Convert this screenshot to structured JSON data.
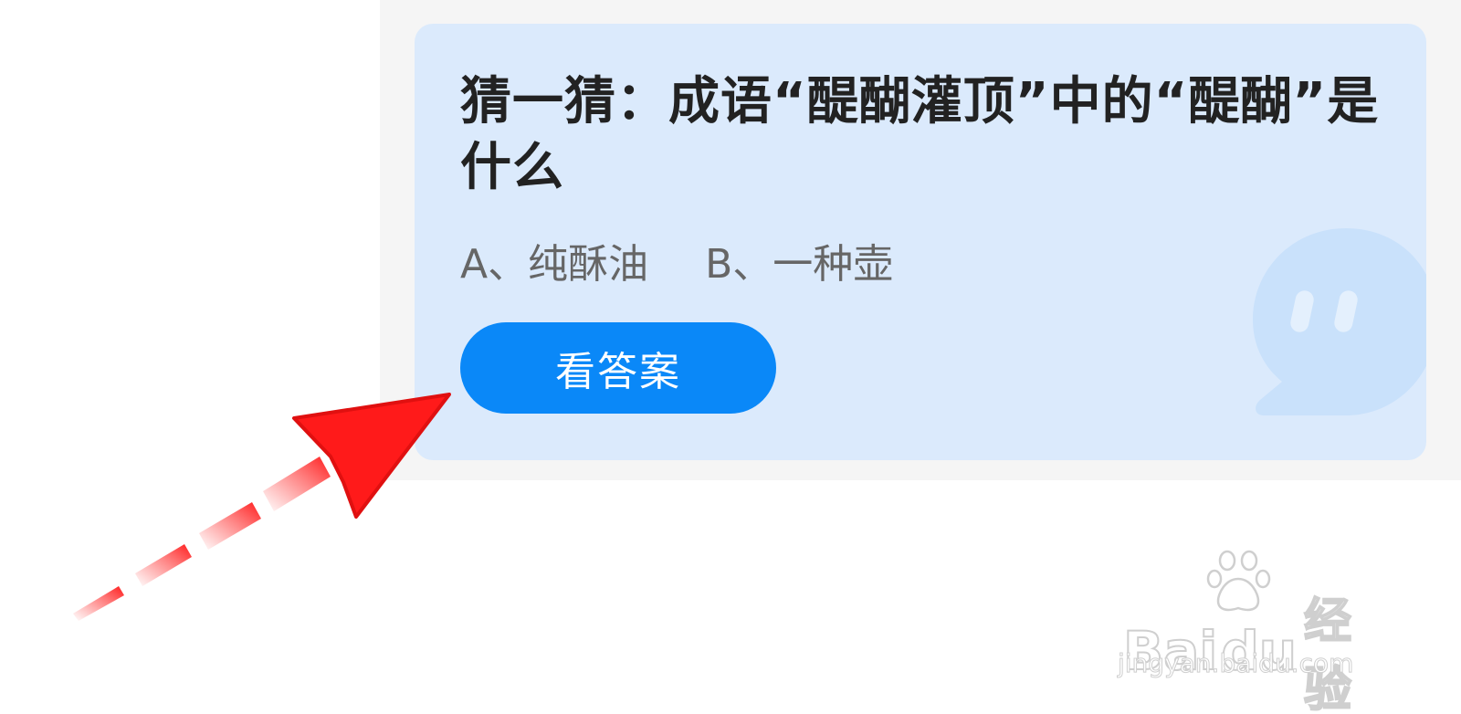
{
  "quiz": {
    "question": "猜一猜：成语“醍醐灌顶”中的“醍醐”是什么",
    "options": [
      {
        "label": "A、纯酥油"
      },
      {
        "label": "B、一种壶"
      }
    ],
    "answer_button_label": "看答案"
  },
  "watermark": {
    "logo_latin": "Bai",
    "logo_du": "du",
    "logo_cn": "经验",
    "url": "jingyan.baidu.com"
  },
  "colors": {
    "card_background": "#dbeafc",
    "button": "#0a88f8",
    "arrow": "#ff1a1a",
    "page_panel": "#f5f5f5"
  },
  "icons": {
    "bubble": "chat-bubble-icon",
    "arrow": "red-arrow-icon",
    "paw": "baidu-paw-icon"
  }
}
